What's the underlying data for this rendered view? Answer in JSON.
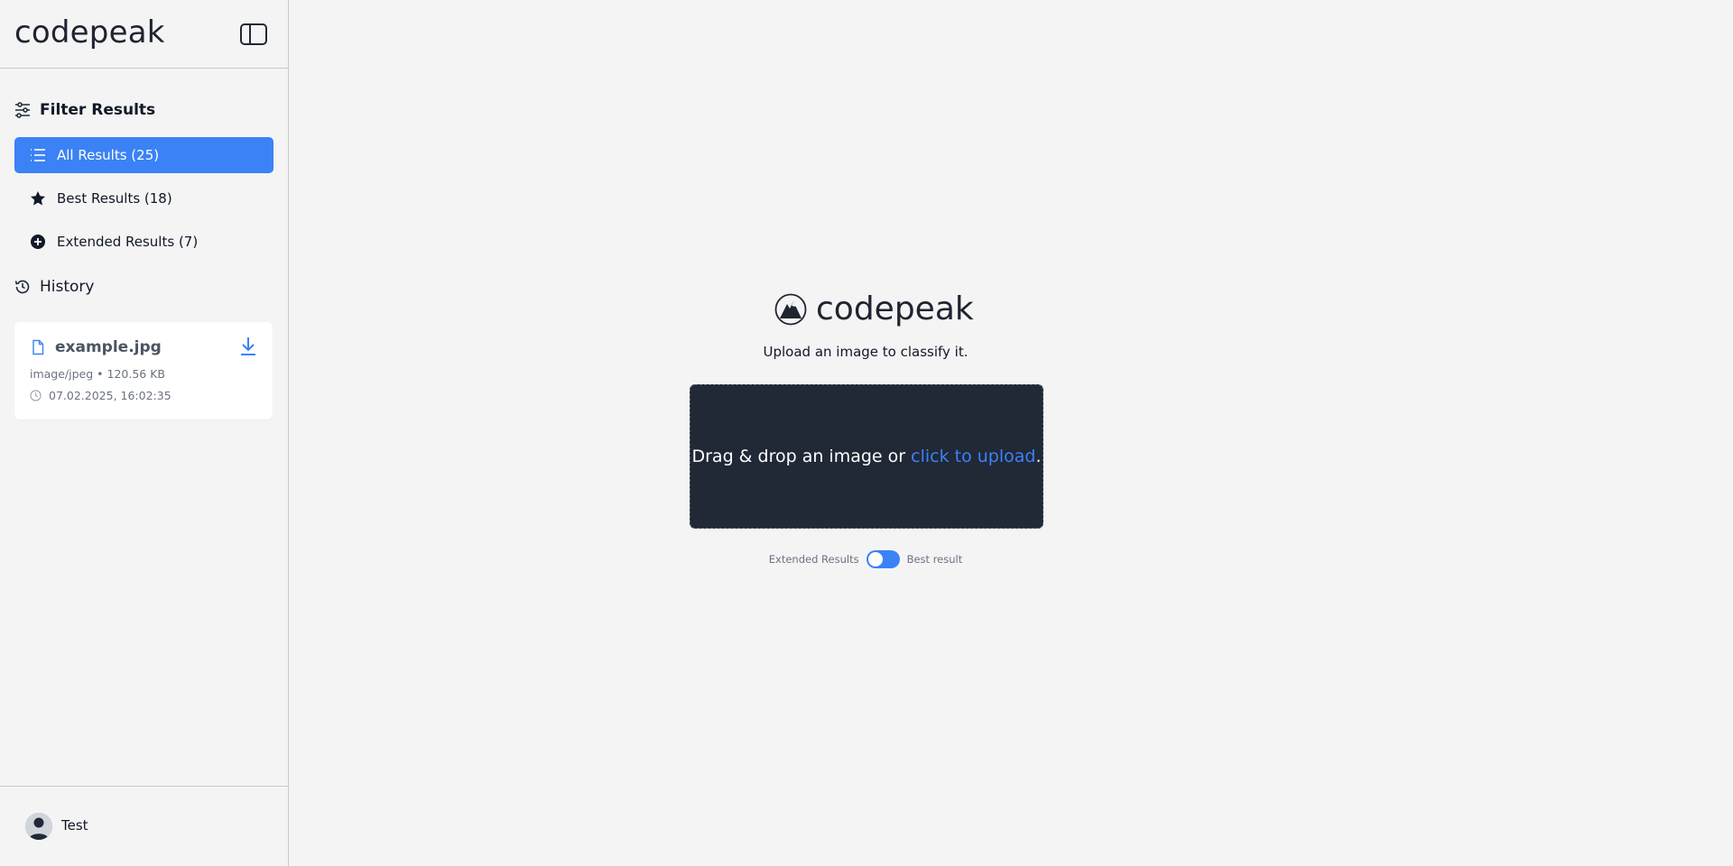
{
  "sidebar": {
    "brand": "codepeak",
    "filter_title": "Filter Results",
    "items": [
      {
        "label": "All Results (25)",
        "icon": "list-icon",
        "active": true
      },
      {
        "label": "Best Results (18)",
        "icon": "star-icon",
        "active": false
      },
      {
        "label": "Extended Results (7)",
        "icon": "plus-circle-icon",
        "active": false
      }
    ],
    "history_title": "History",
    "history": [
      {
        "name": "example.jpg",
        "meta": "image/jpeg • 120.56 KB",
        "time": "07.02.2025, 16:02:35"
      }
    ],
    "user": {
      "name": "Test"
    }
  },
  "main": {
    "logo_text": "codepeak",
    "subtitle": "Upload an image to classify it.",
    "dropzone": {
      "text": "Drag & drop an image or ",
      "link": "click to upload",
      "suffix": "."
    },
    "toggle": {
      "left_label": "Extended Results",
      "right_label": "Best result"
    }
  },
  "colors": {
    "accent": "#3b82f6",
    "dropzone_bg": "#212836",
    "page_bg": "#f4f4f5"
  }
}
